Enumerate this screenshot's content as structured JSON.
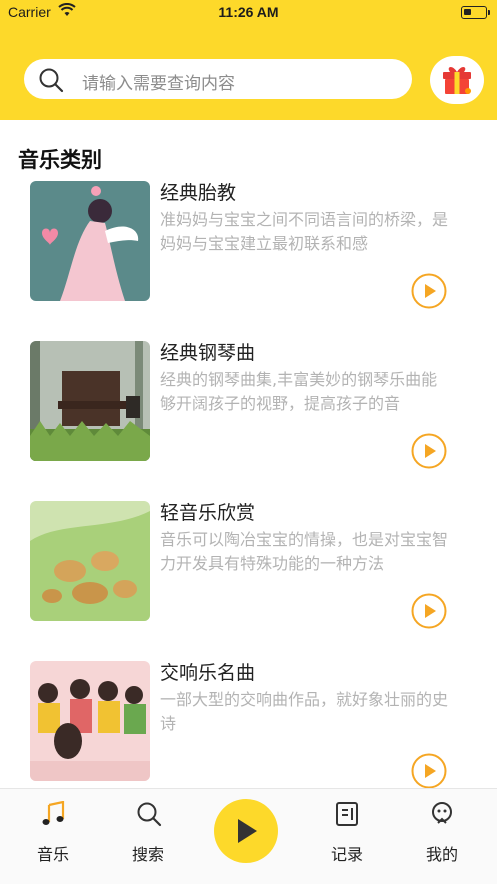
{
  "status_bar": {
    "carrier": "Carrier",
    "time": "11:26 AM"
  },
  "search": {
    "placeholder": "请输入需要查询内容"
  },
  "section_title": "音乐类别",
  "items": [
    {
      "title": "经典胎教",
      "description": "准妈妈与宝宝之间不同语言间的桥梁，是妈妈与宝宝建立最初联系和感",
      "thumbnail": "woman-angel-illustration"
    },
    {
      "title": "经典钢琴曲",
      "description": "经典的钢琴曲集,丰富美妙的钢琴乐曲能够开阔孩子的视野，提高孩子的音",
      "thumbnail": "piano-in-forest"
    },
    {
      "title": "轻音乐欣赏",
      "description": "音乐可以陶冶宝宝的情操，也是对宝宝智力开发具有特殊功能的一种方法",
      "thumbnail": "frogs-in-grass"
    },
    {
      "title": "交响乐名曲",
      "description": "一部大型的交响曲作品，就好象壮丽的史诗",
      "thumbnail": "children-band"
    }
  ],
  "tab_bar": {
    "tabs": [
      {
        "label": "音乐",
        "icon": "music-note-icon"
      },
      {
        "label": "搜索",
        "icon": "search-icon"
      },
      {
        "label": "记录",
        "icon": "record-icon"
      },
      {
        "label": "我的",
        "icon": "profile-icon"
      }
    ],
    "center_icon": "play-icon"
  },
  "colors": {
    "accent": "#FDD92A",
    "play_orange": "#F5A623",
    "desc_gray": "#b3b3b3"
  }
}
